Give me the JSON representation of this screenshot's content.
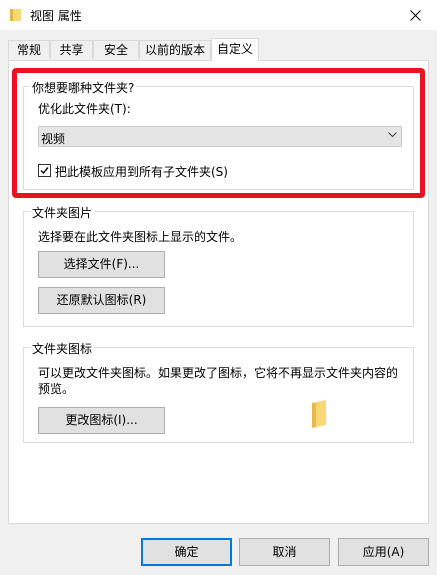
{
  "window": {
    "title": "视图 属性"
  },
  "tabs": [
    {
      "label": "常规"
    },
    {
      "label": "共享"
    },
    {
      "label": "安全"
    },
    {
      "label": "以前的版本"
    },
    {
      "label": "自定义"
    }
  ],
  "optimize_group": {
    "legend": "你想要哪种文件夹?",
    "optimize_label": "优化此文件夹(T):",
    "optimize_value": "视频",
    "apply_checkbox_label": "把此模板应用到所有子文件夹(S)",
    "apply_checked": true
  },
  "folder_pictures_group": {
    "legend": "文件夹图片",
    "description": "选择要在此文件夹图标上显示的文件。",
    "choose_file_button": "选择文件(F)...",
    "restore_default_button": "还原默认图标(R)"
  },
  "folder_icon_group": {
    "legend": "文件夹图标",
    "description_line1": "可以更改文件夹图标。如果更改了图标，它将不再显示文件夹内容的",
    "description_line2": "预览。",
    "change_icon_button": "更改图标(I)..."
  },
  "footer": {
    "ok_button": "确定",
    "cancel_button": "取消",
    "apply_button": "应用(A)"
  },
  "colors": {
    "highlight": "#e8131e",
    "folder": "#f8d775",
    "accent": "#0078d7"
  }
}
